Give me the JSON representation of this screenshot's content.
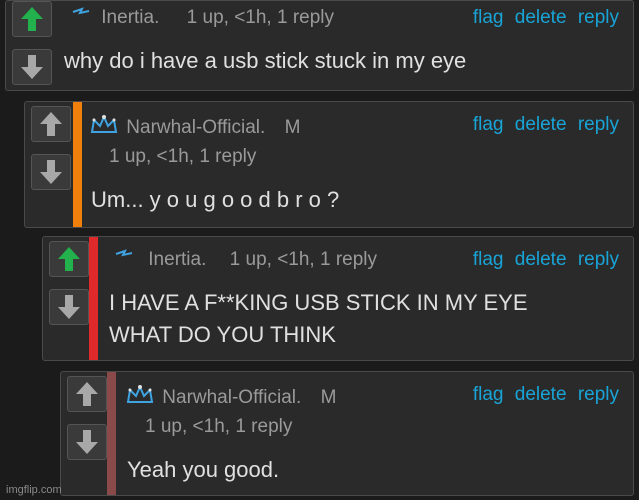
{
  "comments": [
    {
      "username": "Inertia.",
      "stats": "1 up, <1h, 1 reply",
      "text_lines": [
        "why do i have a usb stick stuck in my eye"
      ],
      "badge_icon": "lightning-icon",
      "actions": {
        "flag": "flag",
        "delete": "delete",
        "reply": "reply"
      }
    },
    {
      "username": "Narwhal-Official.",
      "mod_badge": "M",
      "stats": "1 up, <1h, 1 reply",
      "text_lines": [
        "Um... y o u g o o d b r o ?"
      ],
      "badge_icon": "crown-icon",
      "accent_color": "#f07f0b",
      "actions": {
        "flag": "flag",
        "delete": "delete",
        "reply": "reply"
      }
    },
    {
      "username": "Inertia.",
      "stats": "1 up, <1h, 1 reply",
      "text_lines": [
        "I HAVE A F**KING USB STICK IN MY EYE",
        "WHAT DO YOU THINK"
      ],
      "badge_icon": "lightning-icon",
      "accent_color": "#e0292b",
      "actions": {
        "flag": "flag",
        "delete": "delete",
        "reply": "reply"
      }
    },
    {
      "username": "Narwhal-Official.",
      "mod_badge": "M",
      "stats": "1 up, <1h, 1 reply",
      "text_lines": [
        "Yeah you good."
      ],
      "badge_icon": "crown-icon",
      "accent_color": "#8a4a4a",
      "actions": {
        "flag": "flag",
        "delete": "delete",
        "reply": "reply"
      }
    }
  ],
  "colors": {
    "upvote_active": "#22b14c",
    "vote_inactive": "#a8a8a8",
    "link": "#19a4d7",
    "username_blue": "#3ea3e0"
  },
  "watermark": "imgflip.com"
}
